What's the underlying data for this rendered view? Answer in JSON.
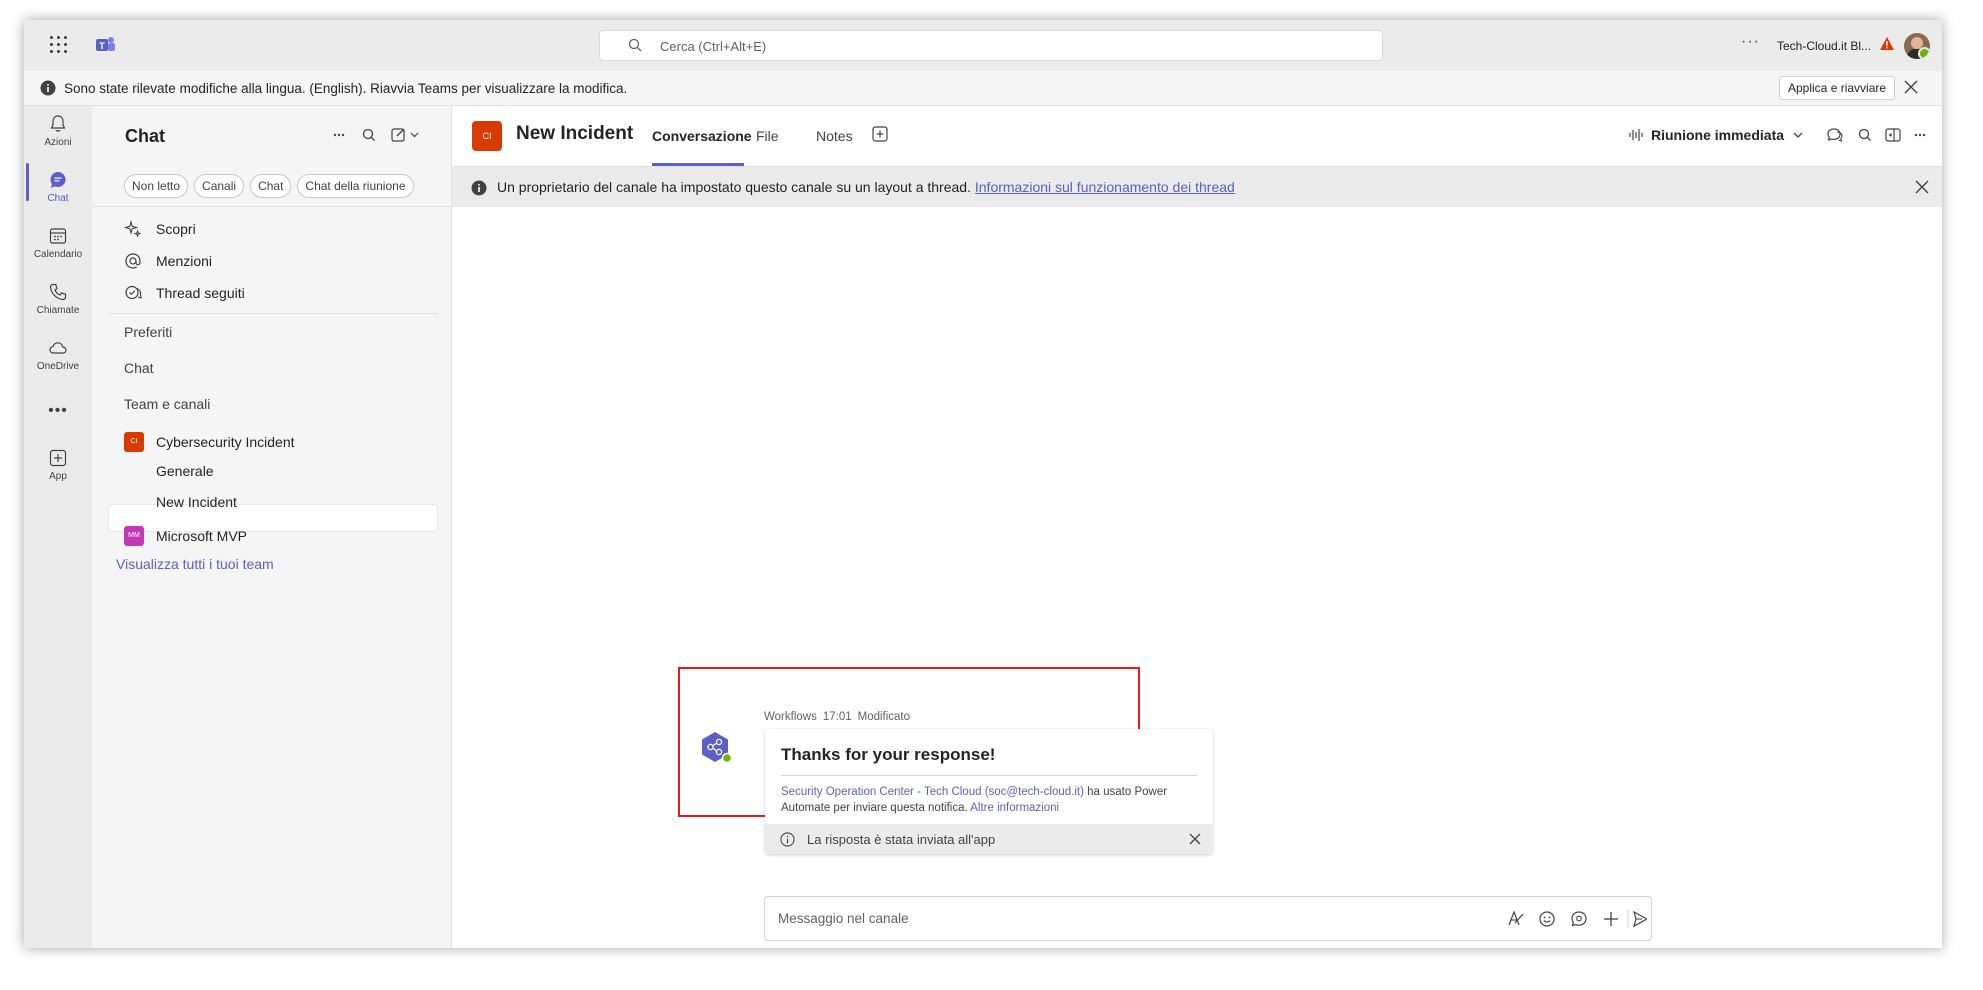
{
  "top": {
    "search_placeholder": "Cerca (Ctrl+Alt+E)",
    "more": "···",
    "tenant": "Tech-Cloud.it Bl..."
  },
  "notice": {
    "text": "Sono state rilevate modifiche alla lingua. (English). Riavvia Teams per visualizzare la modifica.",
    "button": "Applica e riavviare"
  },
  "rail": [
    {
      "label": "Azioni",
      "icon": "bell-icon"
    },
    {
      "label": "Chat",
      "icon": "chat-icon"
    },
    {
      "label": "Calendario",
      "icon": "calendar-icon"
    },
    {
      "label": "Chiamate",
      "icon": "phone-icon"
    },
    {
      "label": "OneDrive",
      "icon": "cloud-icon"
    },
    {
      "label": "App",
      "icon": "add-app-icon"
    }
  ],
  "list": {
    "title": "Chat",
    "filters": [
      "Non letto",
      "Canali",
      "Chat",
      "Chat della riunione"
    ],
    "quick": [
      {
        "label": "Scopri",
        "icon": "sparkle-icon"
      },
      {
        "label": "Menzioni",
        "icon": "at-icon"
      },
      {
        "label": "Thread seguiti",
        "icon": "thread-icon"
      }
    ],
    "sections": [
      "Preferiti",
      "Chat",
      "Team e canali"
    ],
    "teams": [
      {
        "badge": "CI",
        "name": "Cybersecurity Incident",
        "color": "#d83b01",
        "channels": [
          "Generale",
          "New Incident"
        ]
      },
      {
        "badge": "MM",
        "name": "Microsoft MVP",
        "color": "#c239b3",
        "channels": []
      }
    ],
    "see_all": "Visualizza tutti i tuoi team"
  },
  "channel": {
    "badge": "CI",
    "title": "New Incident",
    "tabs": [
      "Conversazione",
      "File",
      "Notes"
    ],
    "meet": "Riunione immediata",
    "banner_text": "Un proprietario del canale ha impostato questo canale su un layout a thread.",
    "banner_link": "Informazioni sul funzionamento dei thread"
  },
  "message": {
    "sender": "Workflows",
    "time": "17:01",
    "status": "Modificato",
    "card_title": "Thanks for your response!",
    "card_link_sender": "Security Operation Center - Tech Cloud (soc@tech-cloud.it)",
    "card_text": " ha usato Power Automate per inviare questa notifica. ",
    "card_more": "Altre informazioni",
    "footer": "La risposta è stata inviata all'app"
  },
  "composer": {
    "placeholder": "Messaggio nel canale"
  },
  "colors": {
    "accent": "#5b5fc7",
    "highlight": "#e21b1b",
    "team_ci": "#d83b01",
    "team_mm": "#c239b3"
  }
}
